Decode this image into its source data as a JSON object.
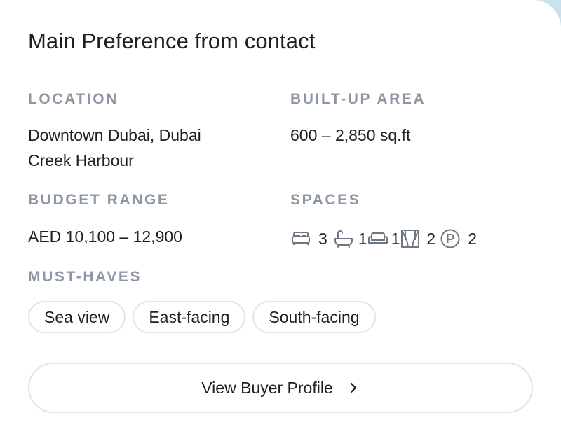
{
  "card": {
    "title": "Main Preference from contact",
    "location": {
      "label": "LOCATION",
      "line1": "Downtown Dubai, Dubai",
      "line2": "Creek Harbour"
    },
    "built_up_area": {
      "label": "BUILT-UP AREA",
      "value": "600 – 2,850 sq.ft"
    },
    "budget_range": {
      "label": "BUDGET RANGE",
      "value": "AED 10,100 – 12,900"
    },
    "spaces": {
      "label": "SPACES",
      "items": [
        {
          "icon": "bed-icon",
          "count": "3"
        },
        {
          "icon": "bathtub-icon",
          "count": "1"
        },
        {
          "icon": "sofa-icon",
          "count": "1"
        },
        {
          "icon": "curtains-icon",
          "count": "2"
        },
        {
          "icon": "parking-icon",
          "count": "2"
        }
      ]
    },
    "must_haves": {
      "label": "MUST-HAVES",
      "tags": [
        "Sea view",
        "East-facing",
        "South-facing"
      ]
    },
    "action": {
      "label": "View Buyer Profile",
      "icon": "chevron-right-icon"
    }
  },
  "colors": {
    "label_gray": "#8d96a3",
    "text_dark": "#1c1f24",
    "border": "#e1e5ea",
    "icon_gray": "#6f7782"
  }
}
